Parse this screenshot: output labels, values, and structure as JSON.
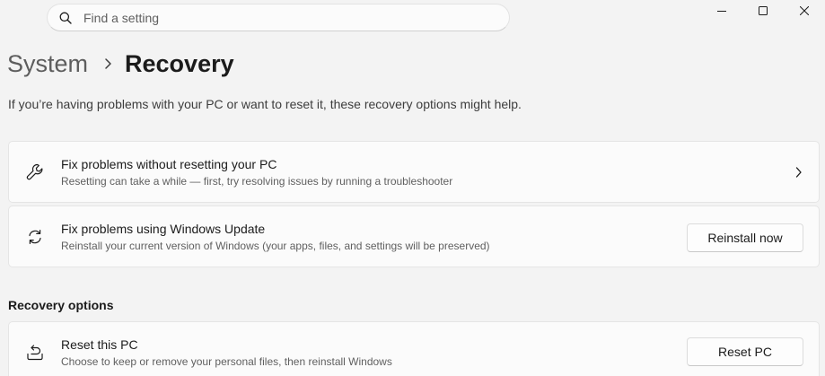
{
  "search": {
    "placeholder": "Find a setting",
    "icon": "search-icon"
  },
  "window_controls": {
    "minimize_icon": "minimize-icon",
    "maximize_icon": "maximize-icon",
    "close_icon": "close-icon"
  },
  "breadcrumb": {
    "parent": "System",
    "current": "Recovery"
  },
  "intro": "If you’re having problems with your PC or want to reset it, these recovery options might help.",
  "cards": [
    {
      "icon": "wrench-icon",
      "title": "Fix problems without resetting your PC",
      "description": "Resetting can take a while — first, try resolving issues by running a troubleshooter",
      "action_icon": "chevron-right-icon"
    },
    {
      "icon": "sync-icon",
      "title": "Fix problems using Windows Update",
      "description": "Reinstall your current version of Windows (your apps, files, and settings will be preserved)",
      "button_label": "Reinstall now"
    }
  ],
  "recovery_options": {
    "section_title": "Recovery options",
    "items": [
      {
        "icon": "reset-pc-icon",
        "title": "Reset this PC",
        "description": "Choose to keep or remove your personal files, then reinstall Windows",
        "button_label": "Reset PC"
      }
    ]
  },
  "colors": {
    "background": "#f3f3f3",
    "card_background": "#fbfbfb",
    "text_primary": "#1b1b1b",
    "text_secondary": "#5f5f5f"
  }
}
